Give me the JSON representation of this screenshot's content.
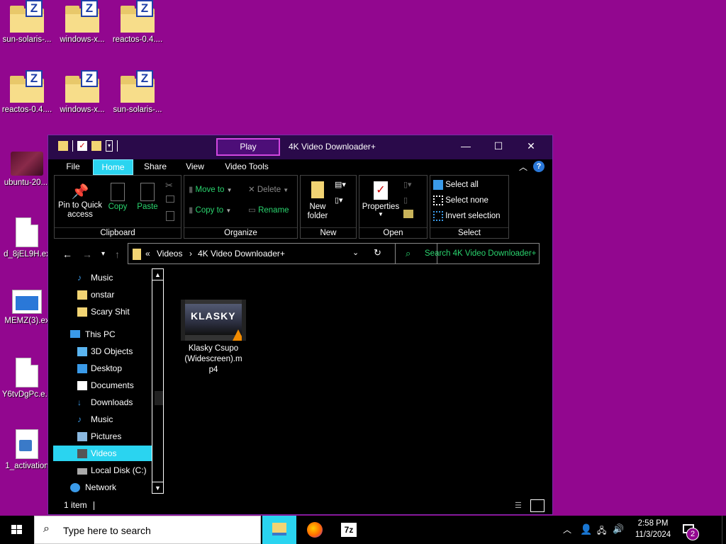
{
  "desktop": {
    "icons": [
      {
        "label": "sun-solaris-..."
      },
      {
        "label": "windows-x..."
      },
      {
        "label": "reactos-0.4...."
      },
      {
        "label": "reactos-0.4...."
      },
      {
        "label": "windows-x..."
      },
      {
        "label": "sun-solaris-..."
      },
      {
        "label": "ubuntu-20...."
      },
      {
        "label": "d_8jEL9H.ex"
      },
      {
        "label": "MEMZ(3).ex"
      },
      {
        "label": "Y6tvDgPc.e..."
      },
      {
        "label": "1_activation"
      }
    ]
  },
  "window": {
    "title": "4K Video Downloader+",
    "contextual_tab": "Play",
    "controls": {
      "minimize": "—",
      "maximize": "☐",
      "close": "✕"
    },
    "menu": {
      "file": "File",
      "home": "Home",
      "share": "Share",
      "view": "View",
      "video_tools": "Video Tools"
    },
    "ribbon": {
      "clipboard": {
        "name": "Clipboard",
        "pin": "Pin to Quick access",
        "copy": "Copy",
        "paste": "Paste"
      },
      "organize": {
        "name": "Organize",
        "move_to": "Move to",
        "copy_to": "Copy to",
        "delete": "Delete",
        "rename": "Rename"
      },
      "new": {
        "name": "New",
        "new_folder": "New folder"
      },
      "open": {
        "name": "Open",
        "properties": "Properties"
      },
      "select": {
        "name": "Select",
        "select_all": "Select all",
        "select_none": "Select none",
        "invert": "Invert selection"
      }
    },
    "address": {
      "chevrons": "«",
      "crumb1": "Videos",
      "sep": "›",
      "crumb2": "4K Video Downloader+"
    },
    "search_placeholder": "Search 4K Video Downloader+",
    "nav_items": [
      {
        "label": "Music",
        "icon": "music-icon"
      },
      {
        "label": "onstar",
        "icon": "folder-icon"
      },
      {
        "label": "Scary Shit",
        "icon": "folder-icon"
      },
      {
        "label": "This PC",
        "icon": "pc-icon"
      },
      {
        "label": "3D Objects",
        "icon": "cube-icon"
      },
      {
        "label": "Desktop",
        "icon": "desktop-icon"
      },
      {
        "label": "Documents",
        "icon": "document-icon"
      },
      {
        "label": "Downloads",
        "icon": "download-icon"
      },
      {
        "label": "Music",
        "icon": "music-icon"
      },
      {
        "label": "Pictures",
        "icon": "picture-icon"
      },
      {
        "label": "Videos",
        "icon": "video-icon"
      },
      {
        "label": "Local Disk (C:)",
        "icon": "disk-icon"
      },
      {
        "label": "Network",
        "icon": "network-icon"
      }
    ],
    "file": {
      "name": "Klasky Csupo (Widescreen).mp4",
      "thumb_text": "KLASKY"
    },
    "status": {
      "count": "1 item"
    }
  },
  "taskbar": {
    "search_placeholder": "Type here to search",
    "time": "2:58 PM",
    "date": "11/3/2024",
    "notif_count": "2"
  },
  "colors": {
    "desktop_bg": "#92078f",
    "accent": "#2ad4f0",
    "green_text": "#2ad46e"
  }
}
